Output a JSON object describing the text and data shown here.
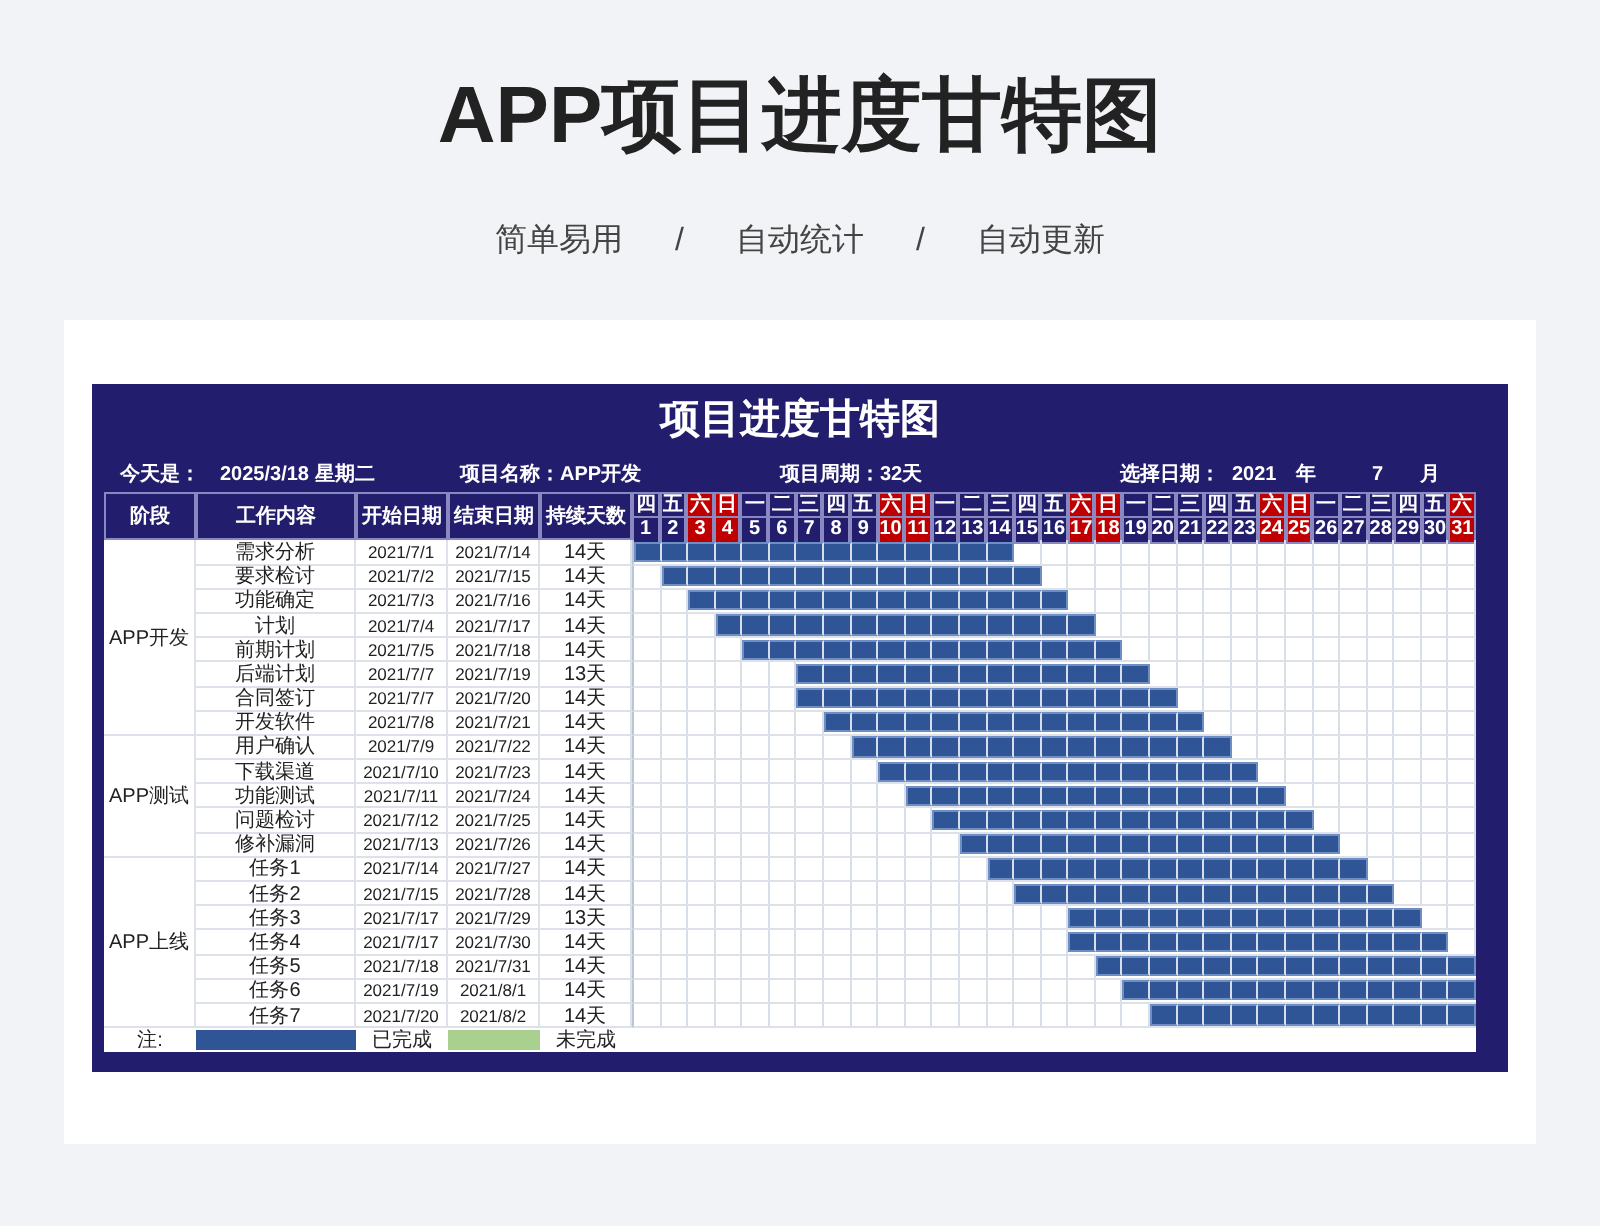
{
  "title": "APP项目进度甘特图",
  "subtitle": [
    "简单易用",
    "/",
    "自动统计",
    "/",
    "自动更新"
  ],
  "sheet": {
    "title": "项目进度甘特图",
    "info": [
      {
        "label": "今天是：",
        "value": "2025/3/18 星期二"
      },
      {
        "label": "项目名称：",
        "value": "APP开发"
      },
      {
        "label": "项目周期：",
        "value": "32天"
      },
      {
        "label": "选择日期：",
        "value": "2021"
      },
      {
        "label": "年",
        "value": "7"
      },
      {
        "label": "月"
      }
    ],
    "columns": [
      "阶段",
      "工作内容",
      "开始日期",
      "结束日期",
      "持续天数"
    ],
    "days": [
      {
        "weekday": "四",
        "day": "1",
        "weekend": false
      },
      {
        "weekday": "五",
        "day": "2",
        "weekend": false
      },
      {
        "weekday": "六",
        "day": "3",
        "weekend": true
      },
      {
        "weekday": "日",
        "day": "4",
        "weekend": true
      },
      {
        "weekday": "一",
        "day": "5",
        "weekend": false
      },
      {
        "weekday": "二",
        "day": "6",
        "weekend": false
      },
      {
        "weekday": "三",
        "day": "7",
        "weekend": false
      },
      {
        "weekday": "四",
        "day": "8",
        "weekend": false
      },
      {
        "weekday": "五",
        "day": "9",
        "weekend": false
      },
      {
        "weekday": "六",
        "day": "10",
        "weekend": true
      },
      {
        "weekday": "日",
        "day": "11",
        "weekend": true
      },
      {
        "weekday": "一",
        "day": "12",
        "weekend": false
      },
      {
        "weekday": "二",
        "day": "13",
        "weekend": false
      },
      {
        "weekday": "三",
        "day": "14",
        "weekend": false
      },
      {
        "weekday": "四",
        "day": "15",
        "weekend": false
      },
      {
        "weekday": "五",
        "day": "16",
        "weekend": false
      },
      {
        "weekday": "六",
        "day": "17",
        "weekend": true
      },
      {
        "weekday": "日",
        "day": "18",
        "weekend": true
      },
      {
        "weekday": "一",
        "day": "19",
        "weekend": false
      },
      {
        "weekday": "二",
        "day": "20",
        "weekend": false
      },
      {
        "weekday": "三",
        "day": "21",
        "weekend": false
      },
      {
        "weekday": "四",
        "day": "22",
        "weekend": false
      },
      {
        "weekday": "五",
        "day": "23",
        "weekend": false
      },
      {
        "weekday": "六",
        "day": "24",
        "weekend": true
      },
      {
        "weekday": "日",
        "day": "25",
        "weekend": true
      },
      {
        "weekday": "一",
        "day": "26",
        "weekend": false
      },
      {
        "weekday": "二",
        "day": "27",
        "weekend": false
      },
      {
        "weekday": "三",
        "day": "28",
        "weekend": false
      },
      {
        "weekday": "四",
        "day": "29",
        "weekend": false
      },
      {
        "weekday": "五",
        "day": "30",
        "weekend": false
      },
      {
        "weekday": "六",
        "day": "31",
        "weekend": true
      }
    ],
    "groups": [
      {
        "stage": "APP开发",
        "rows": [
          {
            "task": "需求分析",
            "start": "2021/7/1",
            "end": "2021/7/14",
            "days": "14天",
            "timeline": [
              true,
              true,
              true,
              true,
              true,
              true,
              true,
              true,
              true,
              true,
              true,
              true,
              true,
              true,
              false,
              false,
              false,
              false,
              false,
              false,
              false,
              false,
              false,
              false,
              false,
              false,
              false,
              false,
              false,
              false,
              false
            ]
          },
          {
            "task": "要求检讨",
            "start": "2021/7/2",
            "end": "2021/7/15",
            "days": "14天",
            "timeline": [
              false,
              true,
              true,
              true,
              true,
              true,
              true,
              true,
              true,
              true,
              true,
              true,
              true,
              true,
              true,
              false,
              false,
              false,
              false,
              false,
              false,
              false,
              false,
              false,
              false,
              false,
              false,
              false,
              false,
              false,
              false
            ]
          },
          {
            "task": "功能确定",
            "start": "2021/7/3",
            "end": "2021/7/16",
            "days": "14天",
            "timeline": [
              false,
              false,
              true,
              true,
              true,
              true,
              true,
              true,
              true,
              true,
              true,
              true,
              true,
              true,
              true,
              true,
              false,
              false,
              false,
              false,
              false,
              false,
              false,
              false,
              false,
              false,
              false,
              false,
              false,
              false,
              false
            ]
          },
          {
            "task": "计划",
            "start": "2021/7/4",
            "end": "2021/7/17",
            "days": "14天",
            "timeline": [
              false,
              false,
              false,
              true,
              true,
              true,
              true,
              true,
              true,
              true,
              true,
              true,
              true,
              true,
              true,
              true,
              true,
              false,
              false,
              false,
              false,
              false,
              false,
              false,
              false,
              false,
              false,
              false,
              false,
              false,
              false
            ]
          },
          {
            "task": "前期计划",
            "start": "2021/7/5",
            "end": "2021/7/18",
            "days": "14天",
            "timeline": [
              false,
              false,
              false,
              false,
              true,
              true,
              true,
              true,
              true,
              true,
              true,
              true,
              true,
              true,
              true,
              true,
              true,
              true,
              false,
              false,
              false,
              false,
              false,
              false,
              false,
              false,
              false,
              false,
              false,
              false,
              false
            ]
          },
          {
            "task": "后端计划",
            "start": "2021/7/7",
            "end": "2021/7/19",
            "days": "13天",
            "timeline": [
              false,
              false,
              false,
              false,
              false,
              false,
              true,
              true,
              true,
              true,
              true,
              true,
              true,
              true,
              true,
              true,
              true,
              true,
              true,
              false,
              false,
              false,
              false,
              false,
              false,
              false,
              false,
              false,
              false,
              false,
              false
            ]
          },
          {
            "task": "合同签订",
            "start": "2021/7/7",
            "end": "2021/7/20",
            "days": "14天",
            "timeline": [
              false,
              false,
              false,
              false,
              false,
              false,
              true,
              true,
              true,
              true,
              true,
              true,
              true,
              true,
              true,
              true,
              true,
              true,
              true,
              true,
              false,
              false,
              false,
              false,
              false,
              false,
              false,
              false,
              false,
              false,
              false
            ]
          },
          {
            "task": "开发软件",
            "start": "2021/7/8",
            "end": "2021/7/21",
            "days": "14天",
            "timeline": [
              false,
              false,
              false,
              false,
              false,
              false,
              false,
              true,
              true,
              true,
              true,
              true,
              true,
              true,
              true,
              true,
              true,
              true,
              true,
              true,
              true,
              false,
              false,
              false,
              false,
              false,
              false,
              false,
              false,
              false,
              false
            ]
          }
        ]
      },
      {
        "stage": "APP测试",
        "rows": [
          {
            "task": "用户确认",
            "start": "2021/7/9",
            "end": "2021/7/22",
            "days": "14天",
            "timeline": [
              false,
              false,
              false,
              false,
              false,
              false,
              false,
              false,
              true,
              true,
              true,
              true,
              true,
              true,
              true,
              true,
              true,
              true,
              true,
              true,
              true,
              true,
              false,
              false,
              false,
              false,
              false,
              false,
              false,
              false,
              false
            ]
          },
          {
            "task": "下载渠道",
            "start": "2021/7/10",
            "end": "2021/7/23",
            "days": "14天",
            "timeline": [
              false,
              false,
              false,
              false,
              false,
              false,
              false,
              false,
              false,
              true,
              true,
              true,
              true,
              true,
              true,
              true,
              true,
              true,
              true,
              true,
              true,
              true,
              true,
              false,
              false,
              false,
              false,
              false,
              false,
              false,
              false
            ]
          },
          {
            "task": "功能测试",
            "start": "2021/7/11",
            "end": "2021/7/24",
            "days": "14天",
            "timeline": [
              false,
              false,
              false,
              false,
              false,
              false,
              false,
              false,
              false,
              false,
              true,
              true,
              true,
              true,
              true,
              true,
              true,
              true,
              true,
              true,
              true,
              true,
              true,
              true,
              false,
              false,
              false,
              false,
              false,
              false,
              false
            ]
          },
          {
            "task": "问题检讨",
            "start": "2021/7/12",
            "end": "2021/7/25",
            "days": "14天",
            "timeline": [
              false,
              false,
              false,
              false,
              false,
              false,
              false,
              false,
              false,
              false,
              false,
              true,
              true,
              true,
              true,
              true,
              true,
              true,
              true,
              true,
              true,
              true,
              true,
              true,
              true,
              false,
              false,
              false,
              false,
              false,
              false
            ]
          },
          {
            "task": "修补漏洞",
            "start": "2021/7/13",
            "end": "2021/7/26",
            "days": "14天",
            "timeline": [
              false,
              false,
              false,
              false,
              false,
              false,
              false,
              false,
              false,
              false,
              false,
              false,
              true,
              true,
              true,
              true,
              true,
              true,
              true,
              true,
              true,
              true,
              true,
              true,
              true,
              true,
              false,
              false,
              false,
              false,
              false
            ]
          }
        ]
      },
      {
        "stage": "APP上线",
        "rows": [
          {
            "task": "任务1",
            "start": "2021/7/14",
            "end": "2021/7/27",
            "days": "14天",
            "timeline": [
              false,
              false,
              false,
              false,
              false,
              false,
              false,
              false,
              false,
              false,
              false,
              false,
              false,
              true,
              true,
              true,
              true,
              true,
              true,
              true,
              true,
              true,
              true,
              true,
              true,
              true,
              true,
              false,
              false,
              false,
              false
            ]
          },
          {
            "task": "任务2",
            "start": "2021/7/15",
            "end": "2021/7/28",
            "days": "14天",
            "timeline": [
              false,
              false,
              false,
              false,
              false,
              false,
              false,
              false,
              false,
              false,
              false,
              false,
              false,
              false,
              true,
              true,
              true,
              true,
              true,
              true,
              true,
              true,
              true,
              true,
              true,
              true,
              true,
              true,
              false,
              false,
              false
            ]
          },
          {
            "task": "任务3",
            "start": "2021/7/17",
            "end": "2021/7/29",
            "days": "13天",
            "timeline": [
              false,
              false,
              false,
              false,
              false,
              false,
              false,
              false,
              false,
              false,
              false,
              false,
              false,
              false,
              false,
              false,
              true,
              true,
              true,
              true,
              true,
              true,
              true,
              true,
              true,
              true,
              true,
              true,
              true,
              false,
              false
            ]
          },
          {
            "task": "任务4",
            "start": "2021/7/17",
            "end": "2021/7/30",
            "days": "14天",
            "timeline": [
              false,
              false,
              false,
              false,
              false,
              false,
              false,
              false,
              false,
              false,
              false,
              false,
              false,
              false,
              false,
              false,
              true,
              true,
              true,
              true,
              true,
              true,
              true,
              true,
              true,
              true,
              true,
              true,
              true,
              true,
              false
            ]
          },
          {
            "task": "任务5",
            "start": "2021/7/18",
            "end": "2021/7/31",
            "days": "14天",
            "timeline": [
              false,
              false,
              false,
              false,
              false,
              false,
              false,
              false,
              false,
              false,
              false,
              false,
              false,
              false,
              false,
              false,
              false,
              true,
              true,
              true,
              true,
              true,
              true,
              true,
              true,
              true,
              true,
              true,
              true,
              true,
              true
            ]
          },
          {
            "task": "任务6",
            "start": "2021/7/19",
            "end": "2021/8/1",
            "days": "14天",
            "timeline": [
              false,
              false,
              false,
              false,
              false,
              false,
              false,
              false,
              false,
              false,
              false,
              false,
              false,
              false,
              false,
              false,
              false,
              false,
              true,
              true,
              true,
              true,
              true,
              true,
              true,
              true,
              true,
              true,
              true,
              true,
              true
            ]
          },
          {
            "task": "任务7",
            "start": "2021/7/20",
            "end": "2021/8/2",
            "days": "14天",
            "timeline": [
              false,
              false,
              false,
              false,
              false,
              false,
              false,
              false,
              false,
              false,
              false,
              false,
              false,
              false,
              false,
              false,
              false,
              false,
              false,
              true,
              true,
              true,
              true,
              true,
              true,
              true,
              true,
              true,
              true,
              true,
              true
            ]
          }
        ]
      }
    ],
    "legend": {
      "label": "注:",
      "items": [
        {
          "name": "已完成",
          "color": "#2f5597"
        },
        {
          "name": "未完成",
          "color": "#a9d08e"
        }
      ]
    }
  }
}
